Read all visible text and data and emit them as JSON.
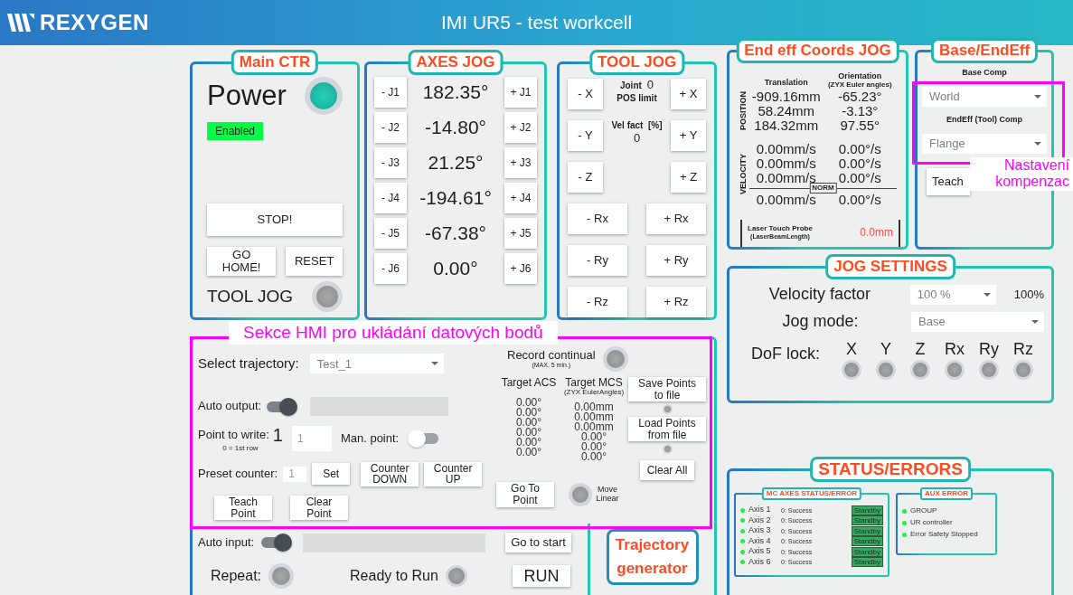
{
  "header": {
    "logo": "REXYGEN",
    "title": "IMI UR5 - test workcell"
  },
  "main_ctr": {
    "title": "Main CTR",
    "power_label": "Power",
    "power_on": true,
    "status_badge": "Enabled",
    "stop_button": "STOP!",
    "home_button": "GO HOME!",
    "reset_button": "RESET",
    "tool_jog_label": "TOOL JOG",
    "tool_jog_on": false
  },
  "axes_jog": {
    "title": "AXES JOG",
    "axes": [
      {
        "minus": "- J1",
        "value": "182.35°",
        "plus": "+ J1"
      },
      {
        "minus": "- J2",
        "value": "-14.80°",
        "plus": "+ J2"
      },
      {
        "minus": "- J3",
        "value": "21.25°",
        "plus": "+ J3"
      },
      {
        "minus": "- J4",
        "value": "-194.61°",
        "plus": "+ J4"
      },
      {
        "minus": "- J5",
        "value": "-67.38°",
        "plus": "+ J5"
      },
      {
        "minus": "- J6",
        "value": "0.00°",
        "plus": "+ J6"
      }
    ]
  },
  "tool_jog": {
    "title": "TOOL JOG",
    "joint_label": "Joint",
    "joint_value": "0",
    "pos_limit_label": "POS limit",
    "vel_fact_label": "Vel fact  [%]",
    "vel_fact_value": "0",
    "linear": [
      {
        "minus": "- X",
        "plus": "+ X"
      },
      {
        "minus": "- Y",
        "plus": "+ Y"
      },
      {
        "minus": "- Z",
        "plus": "+ Z"
      }
    ],
    "rotary": [
      {
        "minus": "- Rx",
        "plus": "+ Rx"
      },
      {
        "minus": "- Ry",
        "plus": "+ Ry"
      },
      {
        "minus": "- Rz",
        "plus": "+ Rz"
      }
    ]
  },
  "end_eff": {
    "title": "End eff Coords JOG",
    "translation_header": "Translation",
    "orientation_header": "Orientation",
    "orientation_note": "(ZYX Euler angles)",
    "position_label": "POSITION",
    "position_rows": [
      {
        "translation": "-909.16mm",
        "orientation": "-65.23°"
      },
      {
        "translation": "58.24mm",
        "orientation": "-3.13°"
      },
      {
        "translation": "184.32mm",
        "orientation": "97.55°"
      }
    ],
    "velocity_label": "VELOCITY",
    "velocity_rows": [
      {
        "translation": "0.00mm/s",
        "orientation": "0.00°/s"
      },
      {
        "translation": "0.00mm/s",
        "orientation": "0.00°/s"
      },
      {
        "translation": "0.00mm/s",
        "orientation": "0.00°/s"
      }
    ],
    "norm_label": "NORM",
    "norm_row": {
      "translation": "0.00mm/s",
      "orientation": "0.00°/s"
    },
    "probe_label": "Laser Touch Probe",
    "probe_note": "(LaserBeamLength)",
    "probe_value": "0.0mm"
  },
  "base_endeff": {
    "title": "Base/EndEff",
    "base_label": "Base Comp",
    "base_value": "World",
    "tool_label": "EndEff (Tool) Comp",
    "tool_value": "Flange",
    "teach_button": "Teach",
    "annotation": [
      "Nastavení",
      "kompenzac"
    ]
  },
  "jog_settings": {
    "title": "JOG SETTINGS",
    "velocity_label": "Velocity factor",
    "velocity_select": "100 %",
    "velocity_value": "100%",
    "jog_mode_label": "Jog mode:",
    "jog_mode_select": "Base",
    "dof_label": "DoF lock:",
    "dof": [
      {
        "axis": "X",
        "locked": false
      },
      {
        "axis": "Y",
        "locked": false
      },
      {
        "axis": "Z",
        "locked": false
      },
      {
        "axis": "Rx",
        "locked": false
      },
      {
        "axis": "Ry",
        "locked": false
      },
      {
        "axis": "Rz",
        "locked": false
      }
    ]
  },
  "trajectory": {
    "annotation": "Sekce HMI pro ukládání datových bodů",
    "select_label": "Select trajectory:",
    "select_value": "Test_1",
    "record_label": "Record continual",
    "record_note": "(MAX. 5 min.)",
    "record_on": false,
    "auto_output_label": "Auto output:",
    "auto_output_on": true,
    "point_label": "Point to write:",
    "point_value": "1",
    "point_note": "0 = 1st row",
    "point_input": "1",
    "man_point_label": "Man. point:",
    "man_point_on": false,
    "preset_label": "Preset counter:",
    "preset_input": "1",
    "set_button": "Set",
    "counter_down_button": "Counter DOWN",
    "counter_up_button": "Counter UP",
    "teach_point_button": "Teach Point",
    "clear_point_button": "Clear Point",
    "target_acs_label": "Target ACS",
    "target_acs": [
      "0.00°",
      "0.00°",
      "0.00°",
      "0.00°",
      "0.00°",
      "0.00°"
    ],
    "target_mcs_label": "Target MCS",
    "target_mcs_note": "(ZYX EulerAngles)",
    "target_mcs": [
      "0.00mm",
      "0.00mm",
      "0.00mm",
      "0.00°",
      "0.00°",
      "0.00°"
    ],
    "save_button": "Save Points to file",
    "save_led_on": false,
    "load_button": "Load Points from file",
    "load_led_on": false,
    "clear_all_button": "Clear All",
    "go_to_point_button": "Go To Point",
    "move_linear_label": "Move Linear",
    "move_linear_on": false,
    "auto_input_label": "Auto input:",
    "auto_input_on": true,
    "go_to_start_button": "Go to start",
    "repeat_label": "Repeat:",
    "repeat_on": false,
    "ready_label": "Ready to Run",
    "ready_on": false,
    "run_button": "RUN",
    "generator_title": "Trajectory generator"
  },
  "status": {
    "title": "STATUS/ERRORS",
    "mc_title": "MC AXES STATUS/ERROR",
    "axes": [
      {
        "name": "Axis 1",
        "message": "0: Success",
        "state": "Standby",
        "ok": true
      },
      {
        "name": "Axis 2",
        "message": "0: Success",
        "state": "Standby",
        "ok": true
      },
      {
        "name": "Axis 3",
        "message": "0: Success",
        "state": "Standby",
        "ok": true
      },
      {
        "name": "Axis 4",
        "message": "0: Success",
        "state": "Standby",
        "ok": true
      },
      {
        "name": "Axis 5",
        "message": "0: Success",
        "state": "Standby",
        "ok": true
      },
      {
        "name": "Axis 6",
        "message": "0: Success",
        "state": "Standby",
        "ok": true
      }
    ],
    "aux_title": "AUX ERROR",
    "aux": [
      {
        "name": "GROUP",
        "ok": true
      },
      {
        "name": "UR controller",
        "ok": true
      },
      {
        "name": "Error Safety Stopped",
        "ok": true
      }
    ]
  }
}
